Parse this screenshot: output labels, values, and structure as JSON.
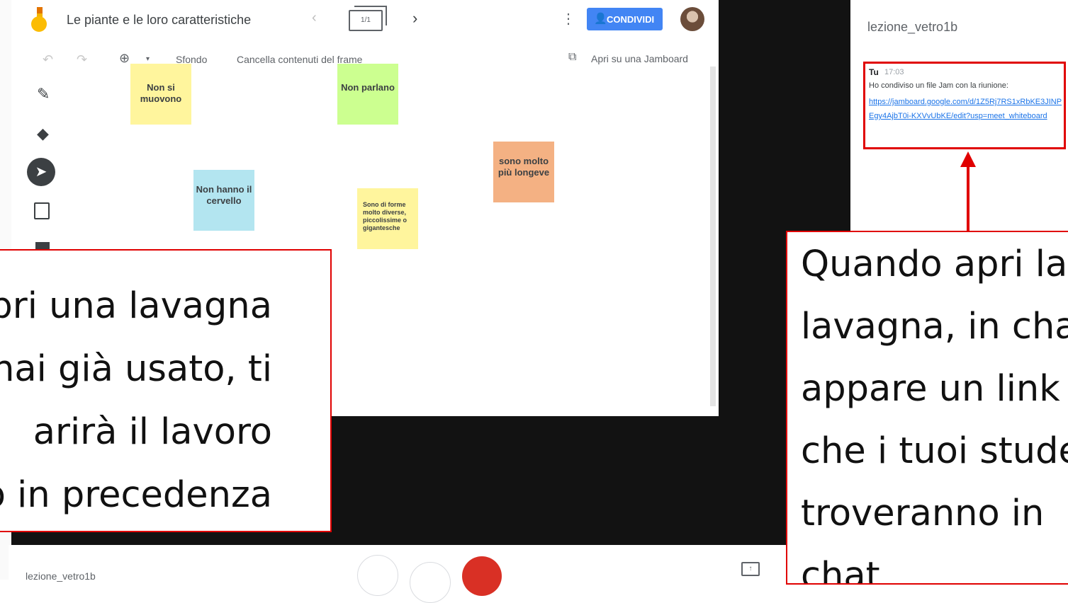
{
  "jamboard": {
    "title": "Le piante e le loro caratteristiche",
    "frame_counter": "1/1",
    "share_button": "CONDIVIDI",
    "toolbar": {
      "background": "Sfondo",
      "clear_frame": "Cancella contenuti del frame",
      "open_in_jamboard": "Apri su una Jamboard"
    },
    "notes": [
      {
        "text": "Non si muovono",
        "color": "#fff59d"
      },
      {
        "text": "Non parlano",
        "color": "#ccff90"
      },
      {
        "text": "sono molto più longeve",
        "color": "#f4b183"
      },
      {
        "text": "Non hanno il cervello",
        "color": "#b3e5f0"
      },
      {
        "text": "Sono di forme molto diverse, piccolissime o gigantesche",
        "color": "#fff59d"
      }
    ],
    "icons": [
      "pen-icon",
      "eraser-icon",
      "select-icon",
      "sticky-note-icon",
      "undo-icon",
      "redo-icon",
      "zoom-icon",
      "more-icon",
      "open-external-icon"
    ]
  },
  "meet": {
    "meeting_name": "lezione_vetro1b",
    "end_call_color": "#d93025"
  },
  "chat": {
    "title": "lezione_vetro1b",
    "sender": "Tu",
    "time": "17:03",
    "message": "Ho condiviso un file Jam con la riunione:",
    "link": "https://jamboard.google.com/d/1Z5Rj7RS1xRbKE3JINPEgy4AjbT0i-KXVvUbKE/edit?usp=meet_whiteboard"
  },
  "callouts": {
    "left_lines": [
      "pri una lavagna",
      "hai già usato, ti",
      "arirà il lavoro",
      "o in precedenza"
    ],
    "right_lines": [
      "Quando apri la",
      "lavagna, in cha",
      "appare un link",
      "che i tuoi stude",
      "troveranno in",
      "chat"
    ],
    "highlight_color": "#e00000"
  }
}
